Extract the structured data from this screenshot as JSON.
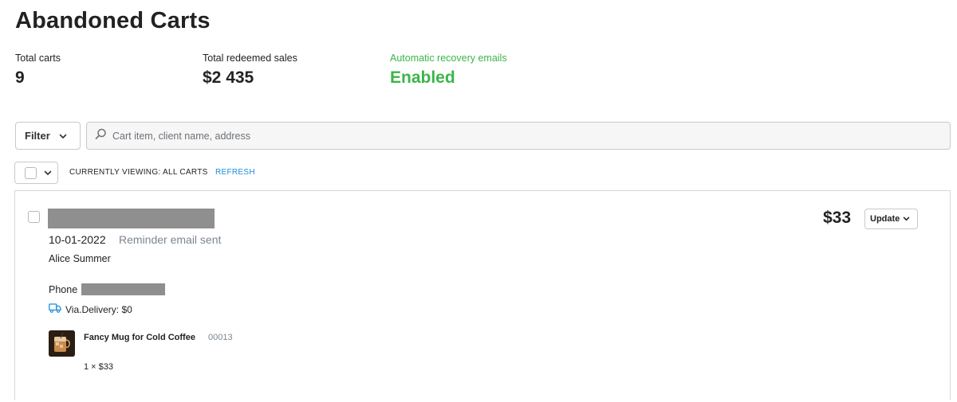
{
  "page": {
    "title": "Abandoned Carts"
  },
  "stats": [
    {
      "label": "Total carts",
      "value": "9"
    },
    {
      "label": "Total redeemed sales",
      "value": "$2 435"
    },
    {
      "label": "Automatic recovery emails",
      "value": "Enabled"
    }
  ],
  "colors": {
    "enabled_green": "#3bb54a",
    "refresh_link": "#1a8fd8",
    "muted": "#7a8591",
    "delivery_icon": "#1a8fd8"
  },
  "toolbar": {
    "filter_label": "Filter",
    "search_placeholder": "Cart item, client name, address",
    "viewing_label": "CURRENTLY VIEWING: ALL CARTS",
    "refresh_label": "REFRESH"
  },
  "cart": {
    "date": "10-01-2022",
    "status": "Reminder email sent",
    "client_name": "Alice Summer",
    "phone_label": "Phone",
    "delivery": "Via.Delivery: $0",
    "total": "$33",
    "update_label": "Update",
    "item": {
      "name": "Fancy Mug for Cold Coffee",
      "sku": "00013",
      "qty_price": "1 × $33"
    }
  },
  "icons": [
    "chevron-down-icon",
    "search-icon",
    "truck-icon"
  ]
}
